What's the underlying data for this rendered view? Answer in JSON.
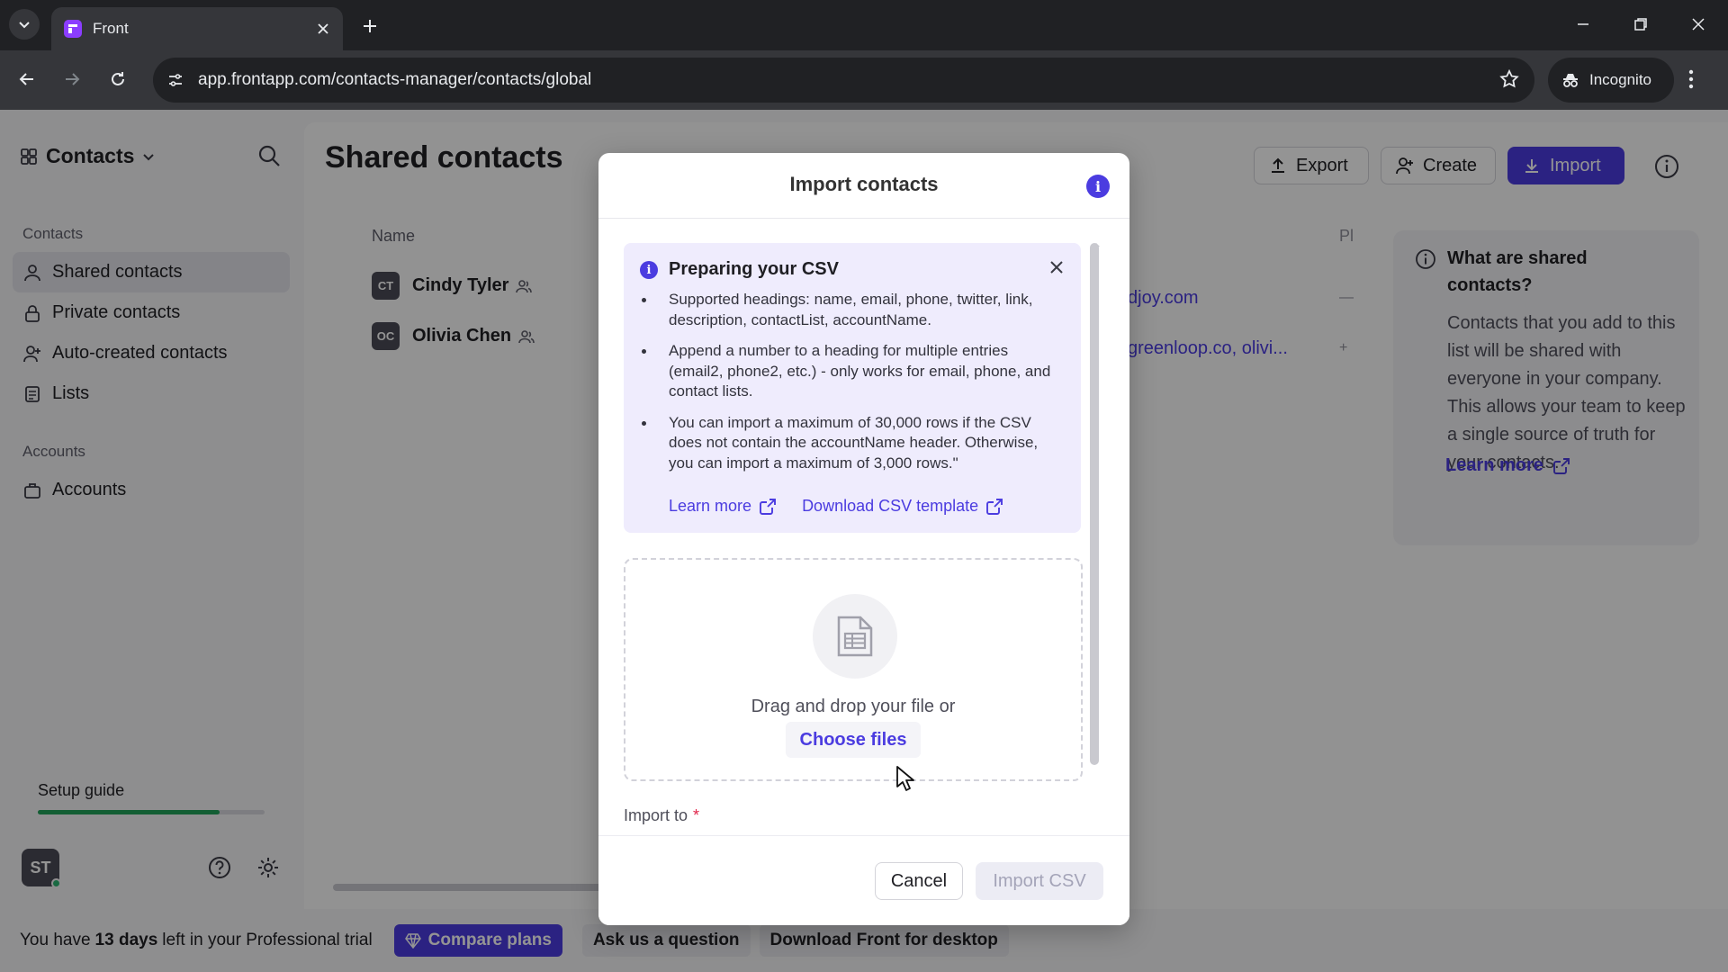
{
  "browser": {
    "tab_title": "Front",
    "url": "app.frontapp.com/contacts-manager/contacts/global",
    "incognito_label": "Incognito"
  },
  "sidebar": {
    "title": "Contacts",
    "section_contacts": "Contacts",
    "items": [
      {
        "label": "Shared contacts",
        "icon": "person-icon",
        "active": true
      },
      {
        "label": "Private contacts",
        "icon": "lock-icon",
        "active": false
      },
      {
        "label": "Auto-created contacts",
        "icon": "person-plus-icon",
        "active": false
      },
      {
        "label": "Lists",
        "icon": "list-icon",
        "active": false
      }
    ],
    "section_accounts": "Accounts",
    "accounts_item": "Accounts",
    "setup_guide": "Setup guide",
    "setup_progress": 0.8,
    "avatar_initials": "ST"
  },
  "main": {
    "title": "Shared contacts",
    "export_label": "Export",
    "create_label": "Create",
    "import_label": "Import",
    "column_name": "Name",
    "column_partial": "Pl",
    "rows": [
      {
        "initials": "CT",
        "name": "Cindy Tyler",
        "email_partial": "djoy.com",
        "extra": "—"
      },
      {
        "initials": "OC",
        "name": "Olivia Chen",
        "email_partial": "greenloop.co, olivi...",
        "extra": "+"
      }
    ],
    "panel_heading": "What are shared contacts?",
    "panel_body": "Contacts that you add to this list will be shared with everyone in your company. This allows your team to keep a single source of truth for your contacts.",
    "panel_learn_more": "Learn more"
  },
  "trial_bar": {
    "text_before": "You have ",
    "days": "13 days",
    "text_after": " left in your Professional trial",
    "compare_plans": "Compare plans",
    "ask_question": "Ask us a question",
    "download_desktop": "Download Front for desktop"
  },
  "modal": {
    "title": "Import contacts",
    "callout_title": "Preparing your CSV",
    "bullets": [
      "Supported headings: name, email, phone, twitter, link, description, contactList, accountName.",
      "Append a number to a heading for multiple entries (email2, phone2, etc.) - only works for email, phone, and contact lists.",
      "You can import a maximum of 30,000 rows if the CSV does not contain the accountName header. Otherwise, you can import a maximum of 3,000 rows.\""
    ],
    "learn_more": "Learn more",
    "download_template": "Download CSV template",
    "drop_text": "Drag and drop your file or",
    "choose_files": "Choose files",
    "import_to_label": "Import to",
    "required_mark": "*",
    "cancel": "Cancel",
    "import_csv": "Import CSV"
  },
  "colors": {
    "accent": "#4b3ce0",
    "callout_bg": "#efecfd",
    "progress": "#21a35b"
  }
}
